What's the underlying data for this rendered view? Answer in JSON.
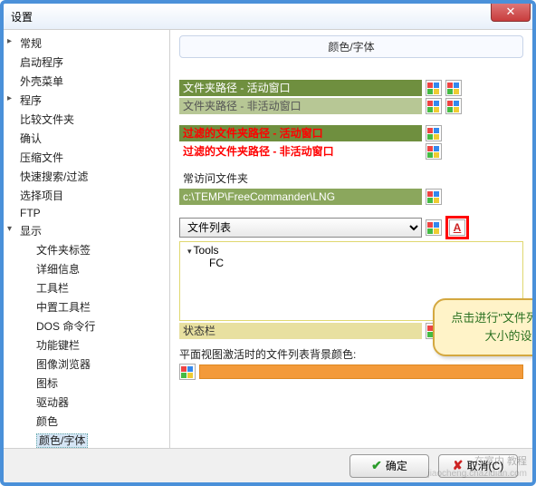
{
  "window": {
    "title": "设置"
  },
  "tree": {
    "items": [
      {
        "label": "常规",
        "cls": "has-children"
      },
      {
        "label": "启动程序"
      },
      {
        "label": "外壳菜单"
      },
      {
        "label": "程序",
        "cls": "has-children"
      },
      {
        "label": "比较文件夹"
      },
      {
        "label": "确认"
      },
      {
        "label": "压缩文件"
      },
      {
        "label": "快速搜索/过滤"
      },
      {
        "label": "选择项目"
      },
      {
        "label": "FTP"
      },
      {
        "label": "显示",
        "cls": "has-children expanded"
      }
    ],
    "subitems": [
      {
        "label": "文件夹标签"
      },
      {
        "label": "详细信息"
      },
      {
        "label": "工具栏"
      },
      {
        "label": "中置工具栏"
      },
      {
        "label": "DOS 命令行"
      },
      {
        "label": "功能键栏"
      },
      {
        "label": "图像浏览器"
      },
      {
        "label": "图标"
      },
      {
        "label": "驱动器"
      },
      {
        "label": "颜色"
      },
      {
        "label": "颜色/字体",
        "selected": true
      }
    ]
  },
  "panel": {
    "title": "颜色/字体",
    "rows": {
      "r1": "文件夹路径 - 活动窗口",
      "r2": "文件夹路径 - 非活动窗口",
      "r3": "过滤的文件夹路径 - 活动窗口",
      "r4": "过滤的文件夹路径 - 非活动窗口",
      "favLabel": "常访问文件夹",
      "favPath": "c:\\TEMP\\FreeCommander\\LNG"
    },
    "selector": {
      "value": "文件列表"
    },
    "fontIcon": "A",
    "treeItems": {
      "root": "Tools",
      "child": "FC"
    },
    "statusLabel": "状态栏",
    "bgLabel": "平面视图激活时的文件列表背景颜色:"
  },
  "callout": "点击进行\"文件列表\"字体大小的设置",
  "footer": {
    "ok": "确定",
    "cancel": "取消(C)"
  },
  "watermark": {
    "l1": "在室内 教程",
    "l2": "jiaocheng.chazidian.com"
  }
}
